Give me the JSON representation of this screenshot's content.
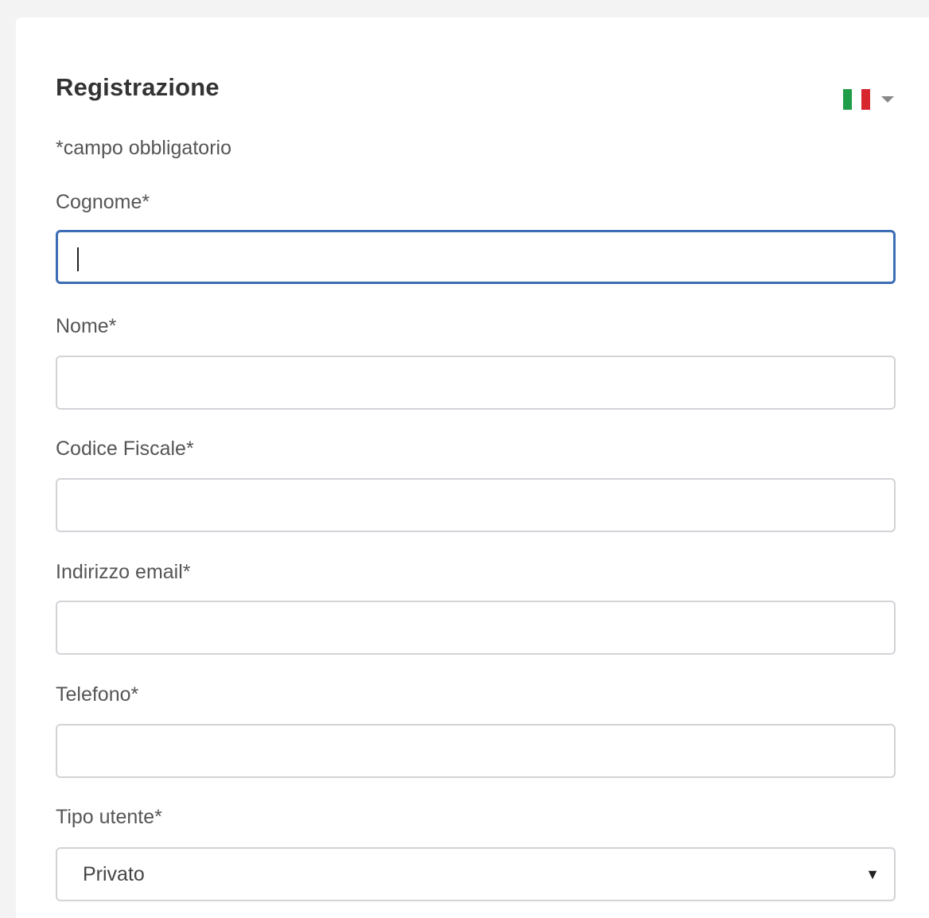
{
  "form": {
    "title": "Registrazione",
    "required_note": "*campo obbligatorio",
    "language": {
      "flag": "italy-flag-icon",
      "colors": [
        "#1f9d48",
        "#ffffff",
        "#d8262e"
      ]
    },
    "fields": {
      "surname": {
        "label": "Cognome*",
        "value": "",
        "focused": true
      },
      "name": {
        "label": "Nome*",
        "value": ""
      },
      "tax_code": {
        "label": "Codice Fiscale*",
        "value": ""
      },
      "email": {
        "label": "Indirizzo email*",
        "value": ""
      },
      "phone": {
        "label": "Telefono*",
        "value": ""
      },
      "user_type": {
        "label": "Tipo utente*",
        "selected": "Privato"
      }
    },
    "accent_color": "#3c6db5"
  }
}
